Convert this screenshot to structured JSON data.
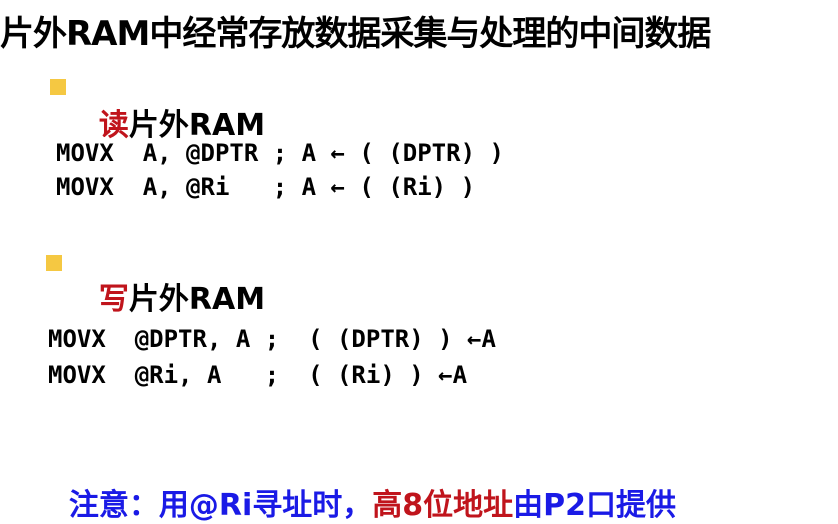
{
  "title": "片外RAM中经常存放数据采集与处理的中间数据",
  "read_section": {
    "keyword": "读",
    "rest": "片外RAM",
    "lines": [
      "MOVX  A, @DPTR ; A ← ( (DPTR) )",
      "MOVX  A, @Ri   ; A ← ( (Ri) )"
    ]
  },
  "write_section": {
    "keyword": "写",
    "rest": "片外RAM",
    "lines": [
      "MOVX  @DPTR, A ;  ( (DPTR) ) ←A",
      "MOVX  @Ri, A   ;  ( (Ri) ) ←A"
    ]
  },
  "note": {
    "part1": "注意：用@Ri寻址时，",
    "part2": "高8位地址",
    "part3": "由P2口提供"
  },
  "colors": {
    "bullet": "#F5C842",
    "keyword_red": "#C0141C",
    "note_blue": "#1A1AE6"
  }
}
